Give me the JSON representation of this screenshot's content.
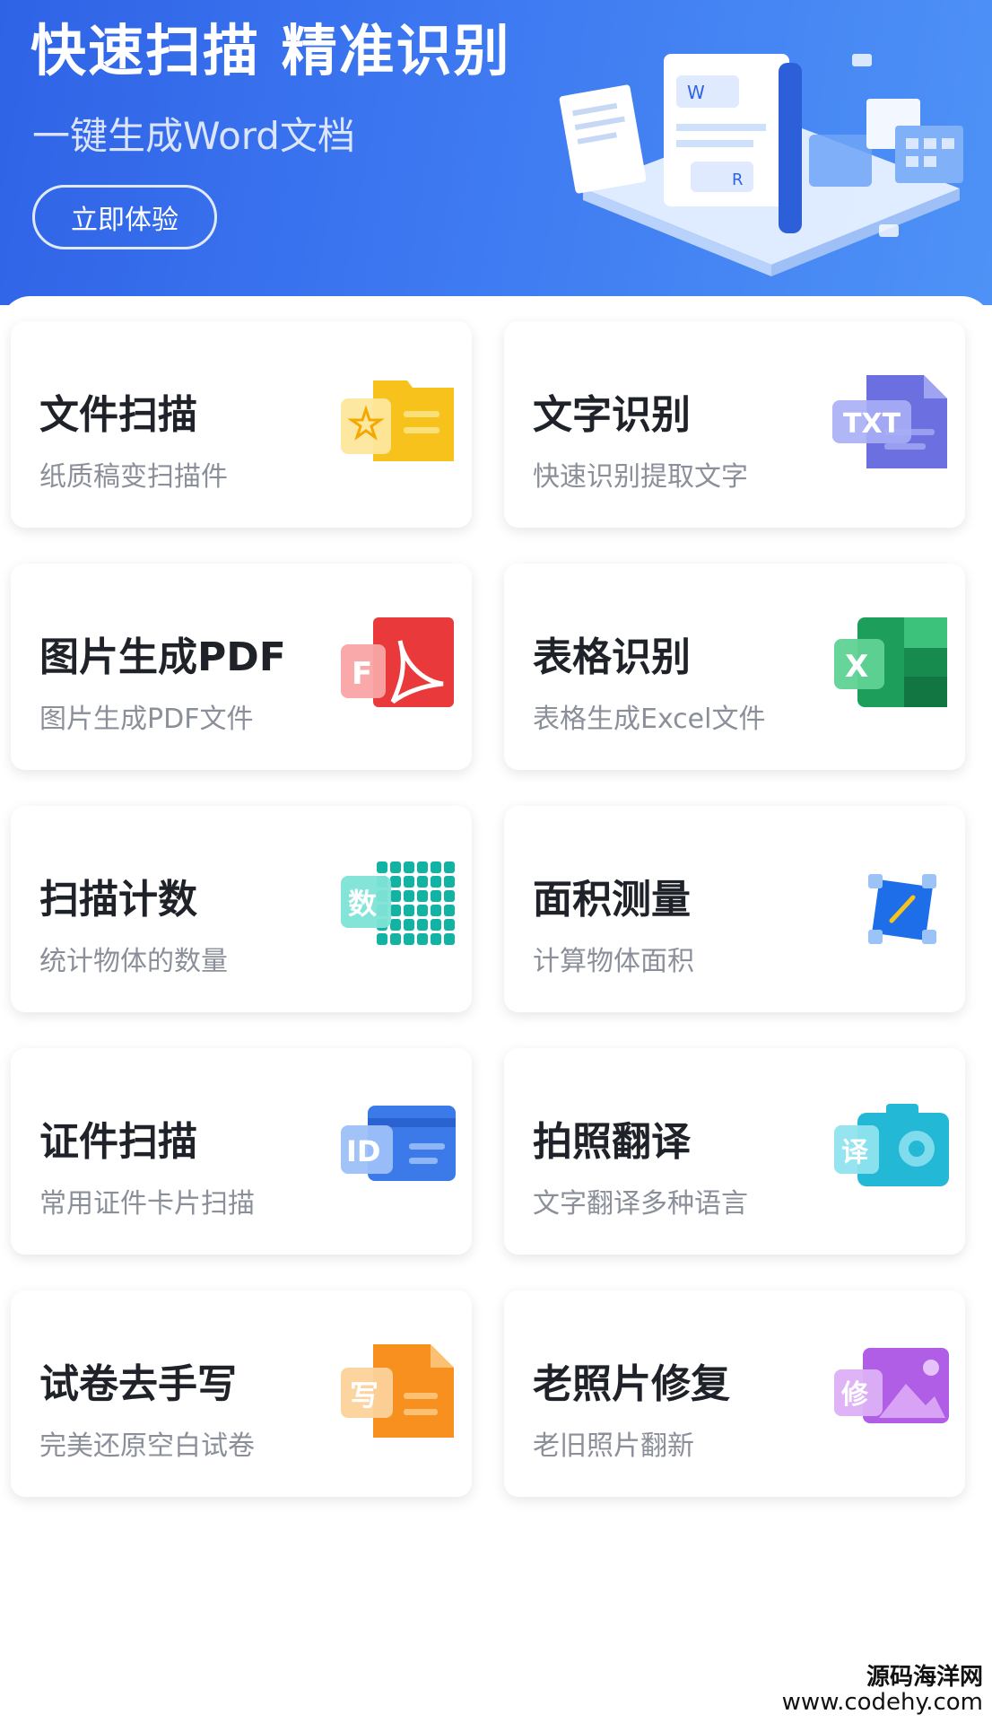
{
  "banner": {
    "title": "快速扫描 精准识别",
    "subtitle": "一键生成Word文档",
    "cta_label": "立即体验"
  },
  "features": [
    {
      "title": "文件扫描",
      "subtitle": "纸质稿变扫描件",
      "icon": "file-scan-icon"
    },
    {
      "title": "文字识别",
      "subtitle": "快速识别提取文字",
      "icon": "txt-icon",
      "icon_text": "TXT"
    },
    {
      "title": "图片生成PDF",
      "subtitle": "图片生成PDF文件",
      "icon": "pdf-icon",
      "icon_text": "F"
    },
    {
      "title": "表格识别",
      "subtitle": "表格生成Excel文件",
      "icon": "excel-icon",
      "icon_text": "X"
    },
    {
      "title": "扫描计数",
      "subtitle": "统计物体的数量",
      "icon": "count-icon",
      "icon_text": "数"
    },
    {
      "title": "面积测量",
      "subtitle": "计算物体面积",
      "icon": "area-measure-icon"
    },
    {
      "title": "证件扫描",
      "subtitle": "常用证件卡片扫描",
      "icon": "id-card-icon",
      "icon_text": "ID"
    },
    {
      "title": "拍照翻译",
      "subtitle": "文字翻译多种语言",
      "icon": "camera-translate-icon",
      "icon_text": "译"
    },
    {
      "title": "试卷去手写",
      "subtitle": "完美还原空白试卷",
      "icon": "exam-handwriting-icon",
      "icon_text": "写"
    },
    {
      "title": "老照片修复",
      "subtitle": "老旧照片翻新",
      "icon": "photo-restore-icon",
      "icon_text": "修"
    }
  ],
  "colors": {
    "banner_start": "#2f63e6",
    "banner_end": "#4e92f6",
    "title_text": "#1f2329",
    "subtitle_text": "#8a8f99"
  },
  "watermark": {
    "line1": "源码海洋网",
    "line2": "www.codehy.com"
  }
}
